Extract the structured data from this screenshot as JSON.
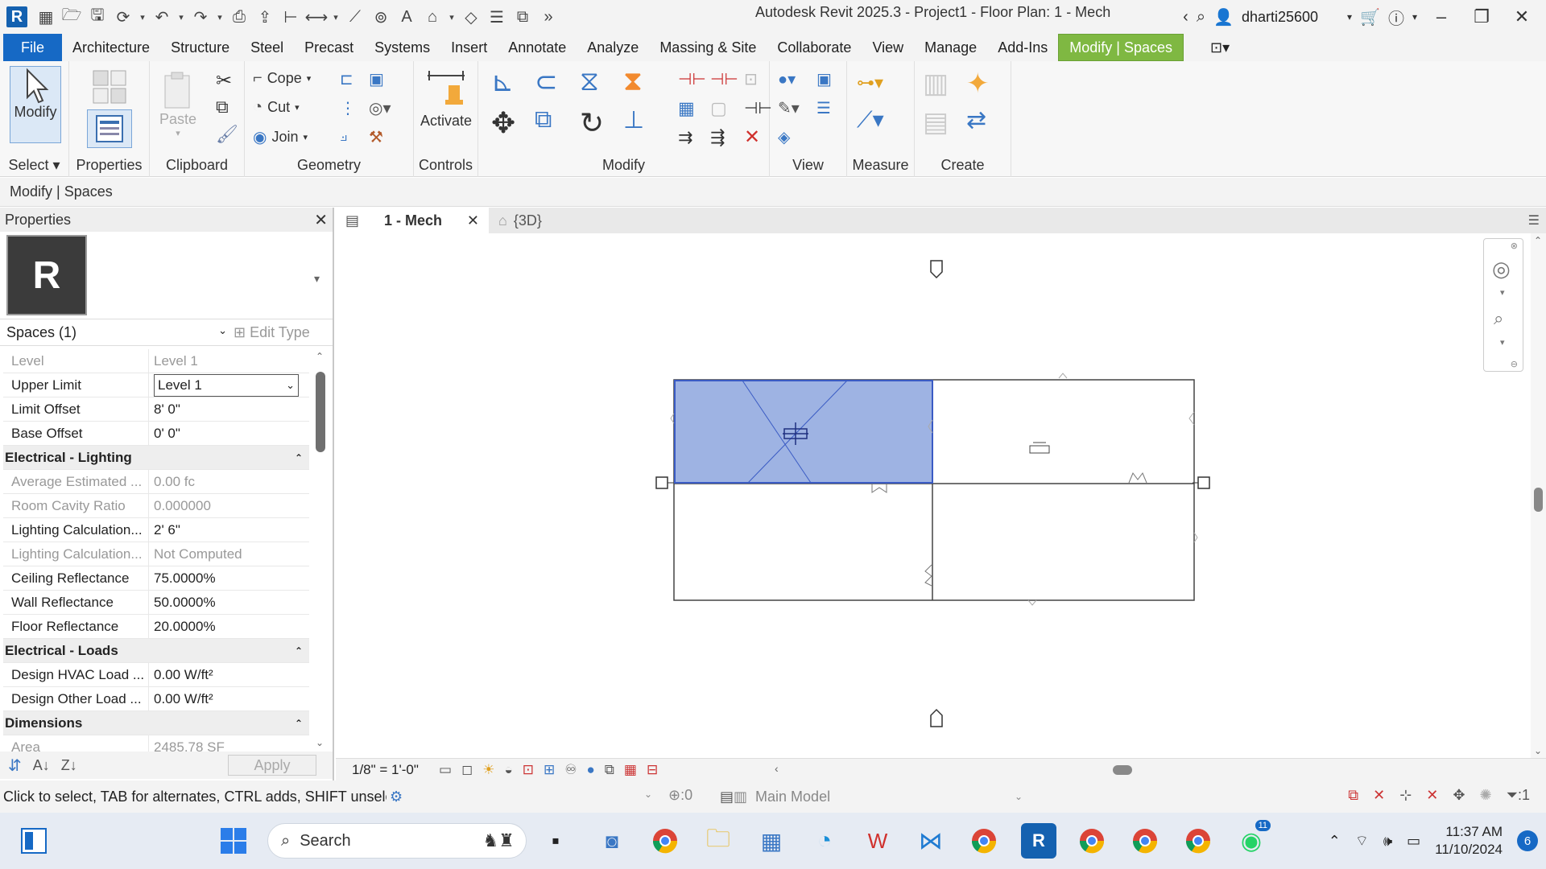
{
  "window": {
    "title": "Autodesk Revit 2025.3 - Project1 - Floor Plan: 1 - Mech",
    "app_logo": "R",
    "user": "dharti25600"
  },
  "menu": {
    "file": "File",
    "tabs": [
      "Architecture",
      "Structure",
      "Steel",
      "Precast",
      "Systems",
      "Insert",
      "Annotate",
      "Analyze",
      "Massing & Site",
      "Collaborate",
      "View",
      "Manage",
      "Add-Ins"
    ],
    "active_tab": "Modify | Spaces"
  },
  "ribbon": {
    "select": {
      "modify_label": "Modify",
      "panel_label": "Select"
    },
    "properties": {
      "label": "Properties"
    },
    "clipboard": {
      "paste_label": "Paste",
      "panel_label": "Clipboard"
    },
    "geometry": {
      "cope_label": "Cope",
      "cut_label": "Cut",
      "join_label": "Join",
      "panel_label": "Geometry"
    },
    "controls": {
      "activate_label": "Activate",
      "panel_label": "Controls"
    },
    "modify": {
      "panel_label": "Modify"
    },
    "view": {
      "panel_label": "View"
    },
    "measure": {
      "panel_label": "Measure"
    },
    "create": {
      "panel_label": "Create"
    }
  },
  "context_bar": {
    "label": "Modify | Spaces"
  },
  "properties": {
    "title": "Properties",
    "type_thumb": "R",
    "selector": "Spaces (1)",
    "edit_type": "Edit Type",
    "rows": [
      {
        "key": "Level",
        "value": "Level 1"
      },
      {
        "key": "Upper Limit",
        "value": "Level 1"
      },
      {
        "key": "Limit Offset",
        "value": "8'  0\""
      },
      {
        "key": "Base Offset",
        "value": "0'  0\""
      }
    ],
    "group_lighting": "Electrical - Lighting",
    "lighting_rows": [
      {
        "key": "Average Estimated ...",
        "value": "0.00 fc"
      },
      {
        "key": "Room Cavity Ratio",
        "value": "0.000000"
      },
      {
        "key": "Lighting Calculation...",
        "value": "2'  6\""
      },
      {
        "key": "Lighting Calculation...",
        "value": "Not Computed"
      },
      {
        "key": "Ceiling Reflectance",
        "value": "75.0000%"
      },
      {
        "key": "Wall Reflectance",
        "value": "50.0000%"
      },
      {
        "key": "Floor Reflectance",
        "value": "20.0000%"
      }
    ],
    "group_loads": "Electrical - Loads",
    "loads_rows": [
      {
        "key": "Design HVAC Load ...",
        "value": "0.00 W/ft²"
      },
      {
        "key": "Design Other Load ...",
        "value": "0.00 W/ft²"
      }
    ],
    "group_dimensions": "Dimensions",
    "dimensions_rows": [
      {
        "key": "Area",
        "value": "2485.78 SF"
      }
    ],
    "apply": "Apply"
  },
  "view_tabs": {
    "active": "1 - Mech",
    "inactive": "{3D}"
  },
  "viewbar": {
    "scale": "1/8\" = 1'-0\""
  },
  "status": {
    "text": "Click to select, TAB for alternates, CTRL adds, SHIFT unselect",
    "worksets_count": ":0",
    "model": "Main Model",
    "filter_count": ":1"
  },
  "taskbar": {
    "search_placeholder": "Search",
    "time": "11:37 AM",
    "date": "11/10/2024",
    "notifications": "6",
    "whatsapp_badge": "11"
  },
  "colors": {
    "accent": "#7fb842",
    "file_tab": "#1669c5",
    "selection_fill": "#9eb3e3",
    "selection_stroke": "#3a5bc4"
  }
}
